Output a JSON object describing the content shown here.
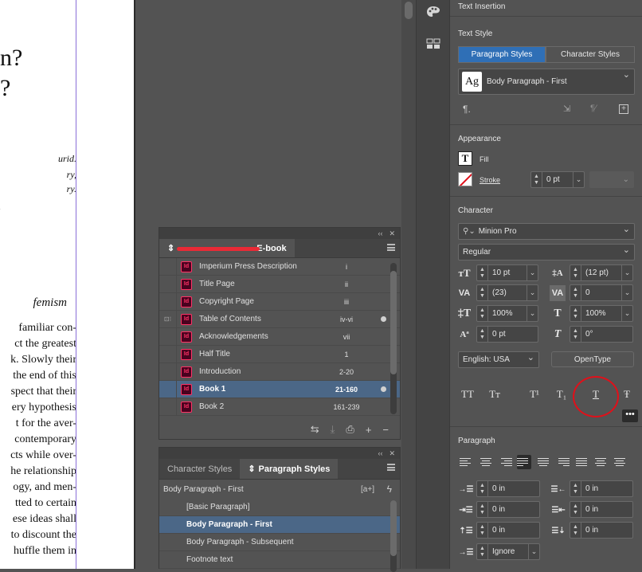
{
  "document": {
    "heading_fragment_1": "n?",
    "heading_fragment_2": "?",
    "italic_lines": [
      "urid.",
      "ry,",
      "ry."
    ],
    "section_heading": "femism",
    "body_lines": [
      "familiar con-",
      "ct the greatest",
      "k. Slowly their",
      "the end of this",
      "spect that their",
      "ery hypothesis",
      "t for the aver-",
      "contemporary",
      "cts while over-",
      "he relationship",
      "ogy, and men-",
      "tted to certain",
      "ese ideas shall",
      "to discount the",
      "huffle them in"
    ]
  },
  "book_panel": {
    "title": "American Extremist E-book",
    "title_visible_suffix": "E-book",
    "rows": [
      {
        "name": "Imperium Press Description",
        "pages": "i",
        "dot": false,
        "selected": false,
        "sync": ""
      },
      {
        "name": "Title Page",
        "pages": "ii",
        "dot": false,
        "selected": false,
        "sync": ""
      },
      {
        "name": "Copyright Page",
        "pages": "iii",
        "dot": false,
        "selected": false,
        "sync": ""
      },
      {
        "name": "Table of Contents",
        "pages": "iv-vi",
        "dot": true,
        "selected": false,
        "sync": "⊡⁝"
      },
      {
        "name": "Acknowledgements",
        "pages": "vii",
        "dot": false,
        "selected": false,
        "sync": ""
      },
      {
        "name": "Half Title",
        "pages": "1",
        "dot": false,
        "selected": false,
        "sync": ""
      },
      {
        "name": "Introduction",
        "pages": "2-20",
        "dot": false,
        "selected": false,
        "sync": ""
      },
      {
        "name": "Book 1",
        "pages": "21-160",
        "dot": true,
        "selected": true,
        "sync": ""
      },
      {
        "name": "Book 2",
        "pages": "161-239",
        "dot": false,
        "selected": false,
        "sync": ""
      }
    ]
  },
  "styles_panel": {
    "tabs": [
      "Character Styles",
      "Paragraph Styles"
    ],
    "current_style": "Body Paragraph - First",
    "new_style_label": "[a+]",
    "items": [
      {
        "label": "[Basic Paragraph]",
        "selected": false
      },
      {
        "label": "Body Paragraph - First",
        "selected": true
      },
      {
        "label": "Body Paragraph - Subsequent",
        "selected": false
      },
      {
        "label": "Footnote text",
        "selected": false
      }
    ]
  },
  "properties": {
    "text_insertion": "Text Insertion",
    "text_style": {
      "title": "Text Style",
      "tab_paragraph": "Paragraph Styles",
      "tab_character": "Character Styles",
      "style_preview": "Ag",
      "style_name": "Body Paragraph - First"
    },
    "appearance": {
      "title": "Appearance",
      "fill_label": "Fill",
      "stroke_label": "Stroke",
      "stroke_weight": "0 pt"
    },
    "character": {
      "title": "Character",
      "font_family": "Minion Pro",
      "font_style": "Regular",
      "font_size": "10 pt",
      "leading": "(12 pt)",
      "kerning": "(23)",
      "tracking": "0",
      "vertical_scale": "100%",
      "horizontal_scale": "100%",
      "baseline_shift": "0 pt",
      "skew": "0°",
      "language": "English: USA",
      "opentype_label": "OpenType",
      "format_buttons": [
        "TT",
        "Tт",
        "T¹",
        "T₁",
        "T",
        "Ŧ"
      ]
    },
    "paragraph": {
      "title": "Paragraph",
      "left_indent": "0 in",
      "right_indent": "0 in",
      "first_line_indent": "0 in",
      "last_line_indent": "0 in",
      "space_before": "0 in",
      "space_after": "0 in",
      "grid_align": "Ignore"
    }
  },
  "colors": {
    "selection": "#4b6787",
    "accent_tab": "#2f6fb6",
    "highlight_circle": "#e0101a",
    "indesign_icon": "#ff3366"
  }
}
